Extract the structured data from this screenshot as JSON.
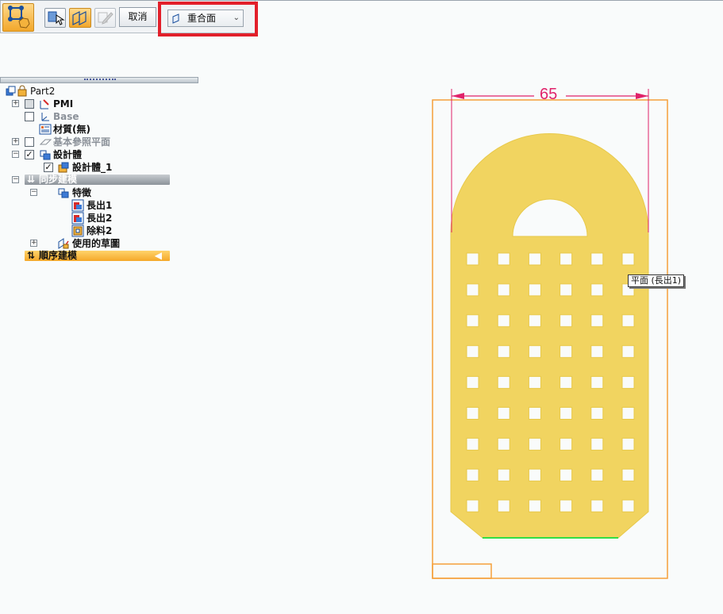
{
  "toolbar": {
    "cancel_label": "取消",
    "face_select": {
      "selected": "重合面"
    }
  },
  "tree": {
    "root": "Part2",
    "pmi": "PMI",
    "base": "Base",
    "material": "材質(無)",
    "ref_planes": "基本參照平面",
    "design_body": "設計體",
    "design_body_1": "設計體_1",
    "sync_modeling": "同步建模",
    "features": "特徵",
    "feature_items": [
      "長出1",
      "長出2",
      "除料2"
    ],
    "used_sketches": "使用的草圖",
    "ordered_modeling": "順序建模"
  },
  "viewport": {
    "dimension_value": "65",
    "tooltip": "平面 (長出1)",
    "hole_grid": {
      "columns": 6,
      "rows": 9
    },
    "colors": {
      "part_fill": "#f1d460",
      "frame": "#f6a03a",
      "dimension": "#e0226a",
      "highlight_edge": "#33dd44"
    }
  }
}
